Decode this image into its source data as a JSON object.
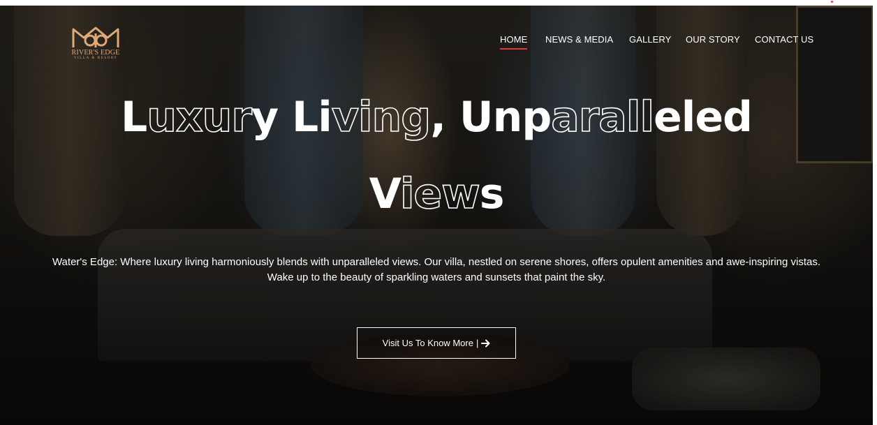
{
  "brand": {
    "name": "RIVER'S EDGE",
    "sub": "VILLA & RESORT",
    "accent": "#e0a978"
  },
  "nav": {
    "items": [
      {
        "label": "HOME",
        "active": true
      },
      {
        "label": "NEWS & MEDIA",
        "active": false
      },
      {
        "label": "GALLERY",
        "active": false
      },
      {
        "label": "OUR STORY",
        "active": false
      },
      {
        "label": "CONTACT US",
        "active": false
      }
    ],
    "active_color": "#e0393b"
  },
  "hero": {
    "headline_line1": "Luxury Living, Unparalleled",
    "headline_line2": "Views",
    "tagline": "Water's Edge: Where luxury living harmoniously blends with unparalleled views. Our villa, nestled on serene shores, offers opulent amenities and awe-inspiring vistas. Wake up to the beauty of sparkling waters and sunsets that paint the sky.",
    "cta_label": "Visit Us To Know More",
    "cta_separator": "|",
    "cta_icon": "arrow-right-icon"
  }
}
